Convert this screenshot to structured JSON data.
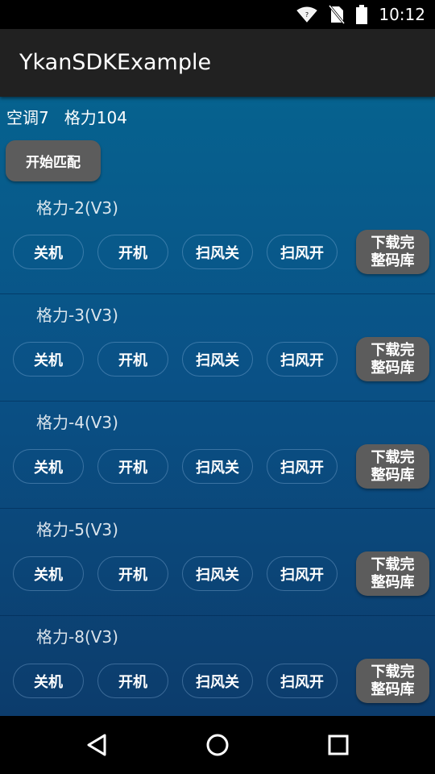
{
  "status_bar": {
    "time": "10:12",
    "icons": [
      "wifi-icon",
      "no-sim-icon",
      "battery-icon"
    ]
  },
  "app_bar": {
    "title": "YkanSDKExample"
  },
  "header": {
    "device_info": "空调7   格力104"
  },
  "match_button": {
    "label": "开始匹配"
  },
  "remotes": [
    {
      "name": "格力-2(V3)",
      "buttons": [
        "关机",
        "开机",
        "扫风关",
        "扫风开"
      ],
      "download_line1": "下载完",
      "download_line2": "整码库"
    },
    {
      "name": "格力-3(V3)",
      "buttons": [
        "关机",
        "开机",
        "扫风关",
        "扫风开"
      ],
      "download_line1": "下载完",
      "download_line2": "整码库"
    },
    {
      "name": "格力-4(V3)",
      "buttons": [
        "关机",
        "开机",
        "扫风关",
        "扫风开"
      ],
      "download_line1": "下载完",
      "download_line2": "整码库"
    },
    {
      "name": "格力-5(V3)",
      "buttons": [
        "关机",
        "开机",
        "扫风关",
        "扫风开"
      ],
      "download_line1": "下载完",
      "download_line2": "整码库"
    },
    {
      "name": "格力-8(V3)",
      "buttons": [
        "关机",
        "开机",
        "扫风关",
        "扫风开"
      ],
      "download_line1": "下载完",
      "download_line2": "整码库"
    }
  ],
  "nav_bar": {
    "icons": [
      "back-icon",
      "home-icon",
      "recents-icon"
    ]
  },
  "colors": {
    "content_top": "#06628f",
    "content_bottom": "#0c3c6c",
    "app_bar": "#212121",
    "button_gray": "#5c5c5c"
  }
}
